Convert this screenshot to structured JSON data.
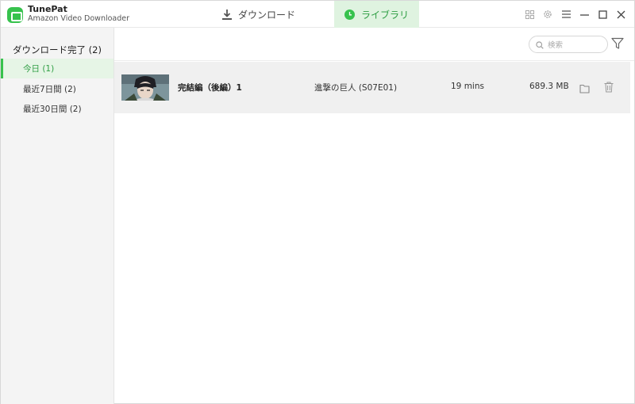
{
  "app": {
    "name": "TunePat",
    "subtitle": "Amazon Video Downloader"
  },
  "tabs": [
    {
      "label": "ダウンロード",
      "icon": "download-icon",
      "active": false
    },
    {
      "label": "ライブラリ",
      "icon": "clock-icon",
      "active": true
    }
  ],
  "window_icons": [
    "grid-icon",
    "gear-icon",
    "menu-icon",
    "minimize-icon",
    "maximize-icon",
    "close-icon"
  ],
  "sidebar": {
    "header": "ダウンロード完了 (2)",
    "items": [
      {
        "label": "今日 (1)",
        "active": true
      },
      {
        "label": "最近7日間 (2)",
        "active": false
      },
      {
        "label": "最近30日間 (2)",
        "active": false
      }
    ]
  },
  "search": {
    "placeholder": "検索"
  },
  "rows": [
    {
      "title": "完結編（後編）1",
      "series": "進撃の巨人 (S07E01)",
      "duration": "19 mins",
      "size": "689.3 MB"
    }
  ],
  "colors": {
    "accent": "#37c24d",
    "accent_text": "#2f9e44",
    "active_tab_bg": "#dff3e0"
  }
}
